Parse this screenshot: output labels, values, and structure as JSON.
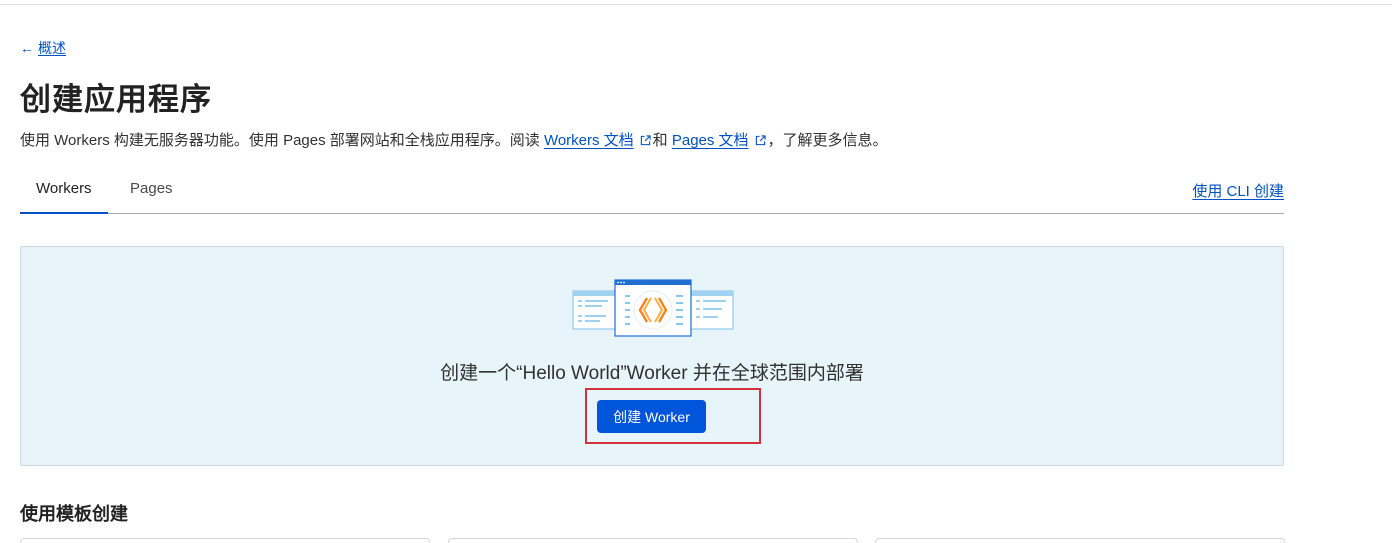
{
  "nav": {
    "back_label": "概述"
  },
  "header": {
    "title": "创建应用程序",
    "description": {
      "part1": "使用 Workers 构建无服务器功能。使用 Pages 部署网站和全栈应用程序。阅读 ",
      "link_workers": "Workers 文档",
      "part2": "和 ",
      "link_pages": "Pages 文档",
      "part3": "，了解更多信息。"
    }
  },
  "tabs": [
    {
      "label": "Workers",
      "active": true
    },
    {
      "label": "Pages",
      "active": false
    }
  ],
  "cli_link": "使用 CLI 创建",
  "hero": {
    "heading": "创建一个“Hello World”Worker 并在全球范围内部署",
    "button_label": "创建 Worker"
  },
  "templates": {
    "title": "使用模板创建"
  },
  "colors": {
    "link": "#0051c3",
    "primary_button": "#0055db",
    "hero_bg": "#e7f4fa",
    "highlight": "#d2323a",
    "illustration_orange": "#f6821f"
  },
  "icons": {
    "back": "arrow-left-icon",
    "external": "external-link-icon",
    "illustration": "workers-illustration"
  }
}
